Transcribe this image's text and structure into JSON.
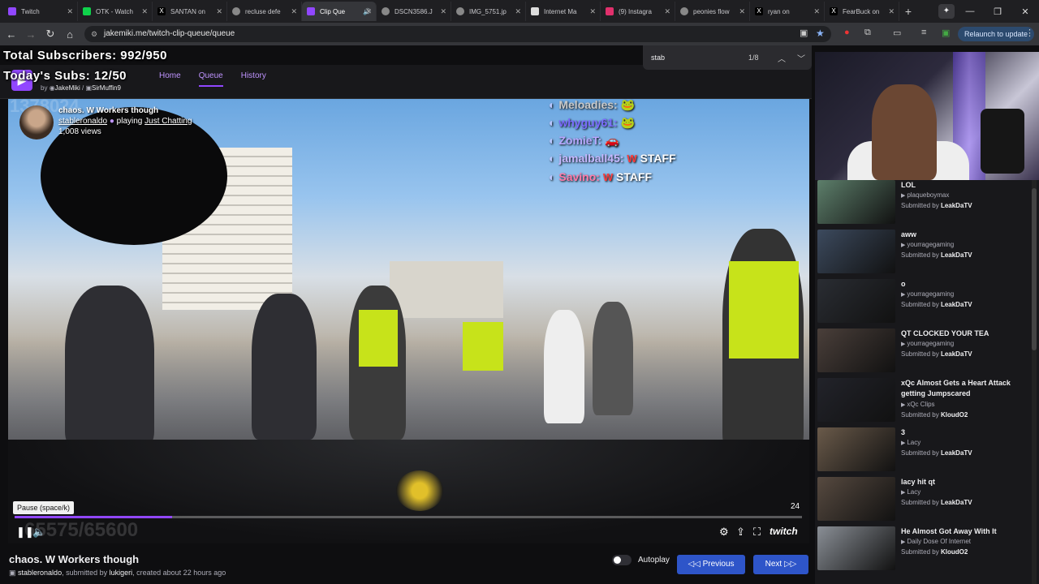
{
  "browser": {
    "tabs": [
      {
        "label": "Twitch",
        "color": "#9147ff"
      },
      {
        "label": "OTK - Watch",
        "color": "#0fd24b"
      },
      {
        "label": "SANTAN on",
        "color": "#cccccc"
      },
      {
        "label": "recluse defe",
        "color": "#cccccc"
      },
      {
        "label": "Clip Que",
        "color": "#9147ff"
      },
      {
        "label": "DSCN3586.J",
        "color": "#cccccc"
      },
      {
        "label": "IMG_5751.jp",
        "color": "#cccccc"
      },
      {
        "label": "Internet Ma",
        "color": "#cccccc"
      },
      {
        "label": "(9) Instagra",
        "color": "#e1306c"
      },
      {
        "label": "peonies flow",
        "color": "#cccccc"
      },
      {
        "label": "ryan on",
        "color": "#cccccc"
      },
      {
        "label": "FearBuck on",
        "color": "#cccccc"
      }
    ],
    "url": "jakemiki.me/twitch-clip-queue/queue",
    "relaunch_label": "Relaunch to update"
  },
  "find": {
    "query": "stab",
    "count": "1/8"
  },
  "overlay": {
    "total_subs": "Total Subscribers: 992/950",
    "today_subs": "Today's Subs: 12/50"
  },
  "site": {
    "byline_prefix": "by",
    "author1": "JakeMiki",
    "author2": "SirMuffin9",
    "nav": [
      "Home",
      "Queue",
      "History"
    ]
  },
  "clip": {
    "title": "chaos. W Workers though",
    "channel": "stableronaldo",
    "playing_word": "playing",
    "category": "Just Chatting",
    "views": "1,008 views",
    "tooltip": "Pause (space/k)",
    "counter": "24",
    "player_logo": "twitch",
    "progress_fraction": 0.2,
    "meta_channel": "stableronaldo",
    "meta_submitted": ", submitted by",
    "meta_submitter": "lukigeri",
    "meta_created": ", created about 22 hours ago",
    "ghost_top": "1378024",
    "ghost_bottom": "65575/65600"
  },
  "chat": [
    {
      "name": "Meloadies:",
      "msg": "",
      "staff": ""
    },
    {
      "name": "whyguy61:",
      "msg": "",
      "staff": ""
    },
    {
      "name": "ZomieT:",
      "msg": "",
      "staff": ""
    },
    {
      "name": "jamalball45:",
      "msg": "W",
      "staff": "STAFF"
    },
    {
      "name": "Savino:",
      "msg": "W",
      "staff": "STAFF"
    }
  ],
  "controls": {
    "autoplay_label": "Autoplay",
    "previous_label": "Previous",
    "next_label": "Next"
  },
  "queue": [
    {
      "title": "LOL",
      "channel": "plaqueboymax",
      "submitted_prefix": "Submitted by",
      "submitter": "LeakDaTV",
      "color": "#5d7f6b"
    },
    {
      "title": "aww",
      "channel": "yourragegaming",
      "submitted_prefix": "Submitted by",
      "submitter": "LeakDaTV",
      "color": "#3c4a5e"
    },
    {
      "title": "o",
      "channel": "yourragegaming",
      "submitted_prefix": "Submitted by",
      "submitter": "LeakDaTV",
      "color": "#2a2d33"
    },
    {
      "title": "QT CLOCKED YOUR TEA",
      "channel": "yourragegaming",
      "submitted_prefix": "Submitted by",
      "submitter": "LeakDaTV",
      "color": "#4a3f3a"
    },
    {
      "title": "xQc Almost Gets a Heart Attack getting Jumpscared",
      "channel": "xQc Clips",
      "submitted_prefix": "Submitted by",
      "submitter": "KloudO2",
      "color": "#22232a"
    },
    {
      "title": "3",
      "channel": "Lacy",
      "submitted_prefix": "Submitted by",
      "submitter": "LeakDaTV",
      "color": "#6a5a4a"
    },
    {
      "title": "lacy hit qt",
      "channel": "Lacy",
      "submitted_prefix": "Submitted by",
      "submitter": "LeakDaTV",
      "color": "#574a40"
    },
    {
      "title": "He Almost Got Away With It",
      "channel": "Daily Dose Of Internet",
      "submitted_prefix": "Submitted by",
      "submitter": "KloudO2",
      "color": "#8a8f96"
    }
  ]
}
